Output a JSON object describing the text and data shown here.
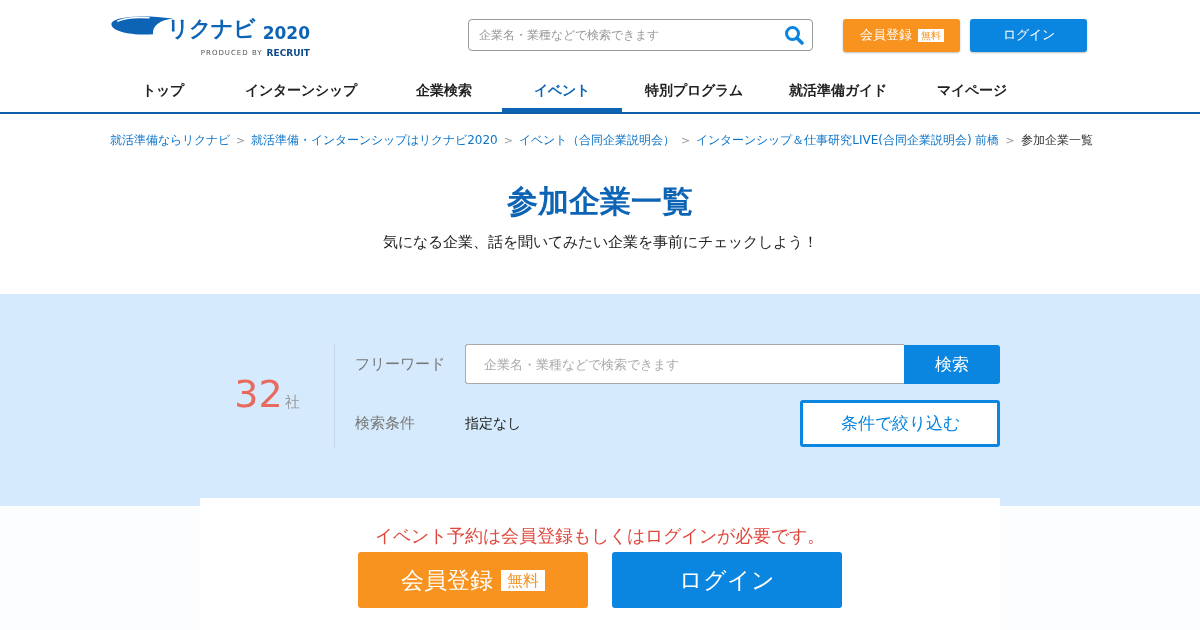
{
  "header": {
    "logo": {
      "name": "リクナビ",
      "year": "2020",
      "produced_by": "PRODUCED BY",
      "company": "RECRUIT"
    },
    "search": {
      "placeholder": "企業名・業種などで検索できます"
    },
    "register_button": {
      "label": "会員登録",
      "badge": "無料"
    },
    "login_button": {
      "label": "ログイン"
    }
  },
  "nav": [
    {
      "label": "トップ",
      "selected": false
    },
    {
      "label": "インターンシップ",
      "selected": false
    },
    {
      "label": "企業検索",
      "selected": false
    },
    {
      "label": "イベント",
      "selected": true
    },
    {
      "label": "特別プログラム",
      "selected": false
    },
    {
      "label": "就活準備ガイド",
      "selected": false
    },
    {
      "label": "マイページ",
      "selected": false
    }
  ],
  "breadcrumb": [
    {
      "label": "就活準備ならリクナビ",
      "link": true
    },
    {
      "label": "就活準備・インターンシップはリクナビ2020",
      "link": true
    },
    {
      "label": "イベント（合同企業説明会）",
      "link": true
    },
    {
      "label": "インターンシップ＆仕事研究LIVE(合同企業説明会) 前橋",
      "link": true
    },
    {
      "label": "参加企業一覧",
      "link": false
    }
  ],
  "breadcrumb_separator": ">",
  "page": {
    "title": "参加企業一覧",
    "subtitle": "気になる企業、話を聞いてみたい企業を事前にチェックしよう！"
  },
  "filter": {
    "count": "32",
    "count_unit": "社",
    "keyword_label": "フリーワード",
    "keyword_placeholder": "企業名・業種などで検索できます",
    "search_button": "検索",
    "condition_label": "検索条件",
    "condition_value": "指定なし",
    "narrow_button": "条件で絞り込む"
  },
  "login_prompt": {
    "message": "イベント予約は会員登録もしくはログインが必要です。",
    "register_button": {
      "label": "会員登録",
      "badge": "無料"
    },
    "login_button": {
      "label": "ログイン"
    }
  }
}
